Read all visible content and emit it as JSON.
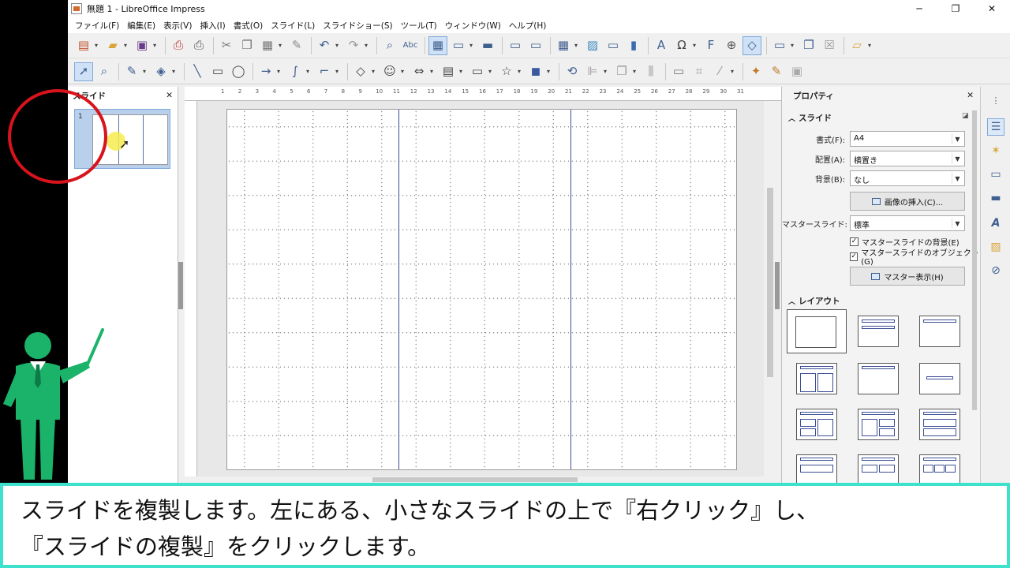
{
  "window": {
    "title": "無題 1 - LibreOffice Impress",
    "controls": {
      "minimize": "─",
      "maximize": "❐",
      "close": "✕"
    }
  },
  "menubar": {
    "items": [
      "ファイル(F)",
      "編集(E)",
      "表示(V)",
      "挿入(I)",
      "書式(O)",
      "スライド(L)",
      "スライドショー(S)",
      "ツール(T)",
      "ウィンドウ(W)",
      "ヘルプ(H)"
    ]
  },
  "slide_pane": {
    "title": "スライド",
    "close_glyph": "✕",
    "slide_number": "1"
  },
  "ruler": {
    "top_numbers": [
      "1",
      "2",
      "3",
      "4",
      "5",
      "6",
      "7",
      "8",
      "9",
      "10",
      "11",
      "12",
      "13",
      "14",
      "15",
      "16",
      "17",
      "18",
      "19",
      "20",
      "21",
      "22",
      "23",
      "24",
      "25",
      "26",
      "27",
      "28",
      "29",
      "30",
      "31"
    ]
  },
  "properties": {
    "title": "プロパティ",
    "close_glyph": "✕",
    "slide_section": "スライド",
    "format_label": "書式(F):",
    "format_value": "A4",
    "orientation_label": "配置(A):",
    "orientation_value": "横置き",
    "background_label": "背景(B):",
    "background_value": "なし",
    "insert_image_button": "画像の挿入(C)...",
    "master_slide_label": "マスタースライド:",
    "master_slide_value": "標準",
    "master_background_check": "マスタースライドの背景(E)",
    "master_objects_check": "マスタースライドのオブジェクト(G)",
    "master_view_button": "マスター表示(H)",
    "layout_section": "レイアウト",
    "check_glyph": "✓"
  },
  "caption": {
    "line1": "スライドを複製します。左にある、小さなスライドの上で『右クリック』し、",
    "line2": "『スライドの複製』をクリックします。"
  },
  "colors": {
    "caption_border": "#3ee1cc",
    "annotation_red": "#d7131b",
    "presenter_green": "#1bb36a",
    "guide_blue": "#3c4f95"
  }
}
